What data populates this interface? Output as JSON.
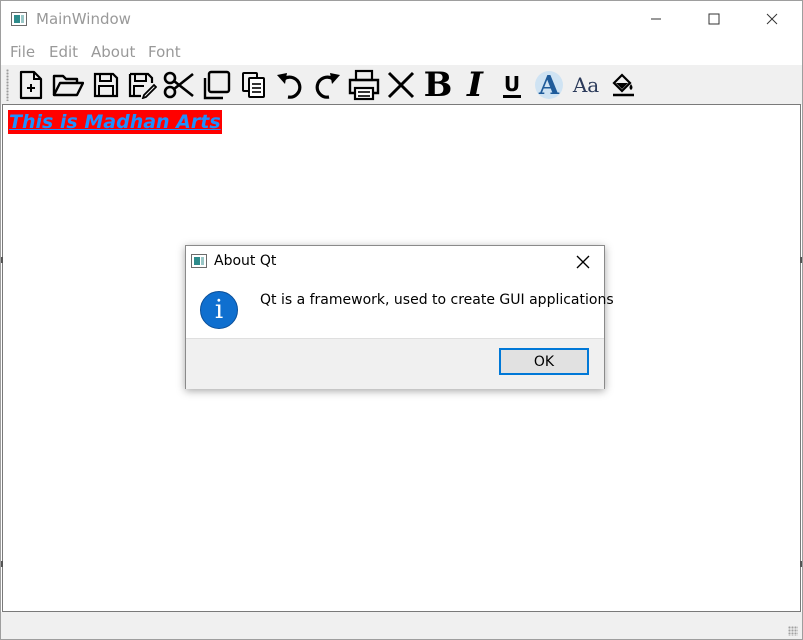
{
  "window": {
    "title": "MainWindow",
    "controls": {
      "minimize": "minimize-icon",
      "maximize": "maximize-icon",
      "close": "close-icon"
    }
  },
  "menubar": {
    "items": [
      {
        "label": "File"
      },
      {
        "label": "Edit"
      },
      {
        "label": "About"
      },
      {
        "label": "Font"
      }
    ]
  },
  "toolbar": {
    "icons": [
      "new-file-icon",
      "open-folder-icon",
      "save-icon",
      "save-as-icon",
      "cut-icon",
      "copy-icon",
      "paste-icon",
      "undo-icon",
      "redo-icon",
      "print-icon",
      "clear-icon",
      "bold-icon",
      "italic-icon",
      "underline-icon",
      "font-icon",
      "font-size-icon",
      "color-fill-icon"
    ],
    "bold_glyph": "B",
    "italic_glyph": "I",
    "underline_glyph": "U",
    "font_glyph": "A",
    "font_size_glyph": "Aa"
  },
  "editor": {
    "content": "This is Madhan Arts",
    "text_color": "#1e90ff",
    "highlight_color": "#ff0000"
  },
  "dialog": {
    "title": "About Qt",
    "message": "Qt is a framework, used to create GUI applications",
    "icon": "info-icon",
    "icon_glyph": "i",
    "ok_label": "OK",
    "accent": "#0078d7"
  }
}
